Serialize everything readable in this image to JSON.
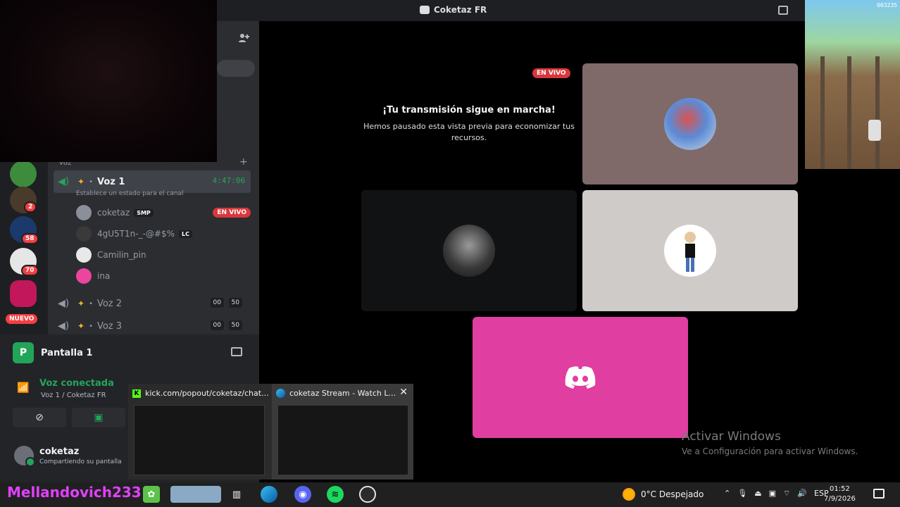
{
  "window": {
    "title": "Coketaz FR"
  },
  "channels": {
    "category_label": "voz",
    "voice_channels": [
      {
        "name": "Voz 1",
        "timer": "4:47:06",
        "status": "Establece un estado para el canal"
      },
      {
        "name": "Voz 2",
        "count_a": "00",
        "count_b": "50"
      },
      {
        "name": "Voz 3",
        "count_a": "00",
        "count_b": "50"
      }
    ],
    "voice_users": [
      {
        "name": "coketaz",
        "tag": "SMP",
        "live": "EN VIVO"
      },
      {
        "name": "4gU5T1n-_-@#$%",
        "tag": "LC"
      },
      {
        "name": "Camilin_pin"
      },
      {
        "name": "ina"
      }
    ]
  },
  "rail": {
    "badges": [
      "2",
      "58",
      "70"
    ],
    "new_label": "NUEVO"
  },
  "stream": {
    "label": "Pantalla 1"
  },
  "voice_connection": {
    "title": "Voz conectada",
    "subtitle": "Voz 1 / Coketaz FR"
  },
  "user": {
    "name": "coketaz",
    "status": "Compartiendo su pantalla"
  },
  "stage": {
    "live_badge": "EN VIVO",
    "paused_title": "¡Tu transmisión sigue en marcha!",
    "paused_text": "Hemos pausado esta vista previa para economizar tus recursos."
  },
  "activation": {
    "title": "Activar Windows",
    "subtitle": "Ve a Configuración para activar Windows."
  },
  "game": {
    "score": "003235"
  },
  "previews": [
    {
      "title": "kick.com/popout/coketaz/chat..."
    },
    {
      "title": "coketaz Stream - Watch L..."
    }
  ],
  "taskbar": {
    "nickname": "Mellandovich233",
    "weather": "0°C  Despejado",
    "lang": "ESP",
    "time": "01:52",
    "date": "7/9/2026"
  },
  "colors": {
    "discord_blurple": "#5865f2",
    "discord_pink_tile": "#eb459f",
    "online_green": "#23a559",
    "live_red": "#da373c"
  }
}
